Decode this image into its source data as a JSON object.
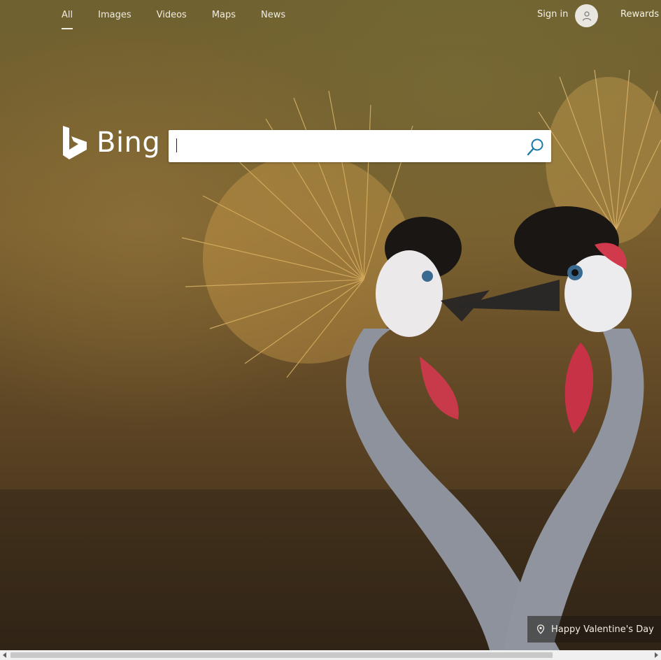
{
  "nav": {
    "items": [
      {
        "label": "All",
        "active": true
      },
      {
        "label": "Images",
        "active": false
      },
      {
        "label": "Videos",
        "active": false
      },
      {
        "label": "Maps",
        "active": false
      },
      {
        "label": "News",
        "active": false
      }
    ]
  },
  "header": {
    "signin_label": "Sign in",
    "avatar_icon": "user-icon",
    "rewards_label": "Rewards"
  },
  "logo": {
    "text": "Bing",
    "icon": "bing-logo-icon"
  },
  "search": {
    "value": "",
    "placeholder": "",
    "button_icon": "search-icon"
  },
  "background": {
    "caption": "Happy Valentine's Day",
    "caption_icon": "location-pin-icon"
  },
  "colors": {
    "nav_text": "#f0ece0",
    "search_icon": "#1b7aa8",
    "caption_bg": "#1e1914"
  }
}
